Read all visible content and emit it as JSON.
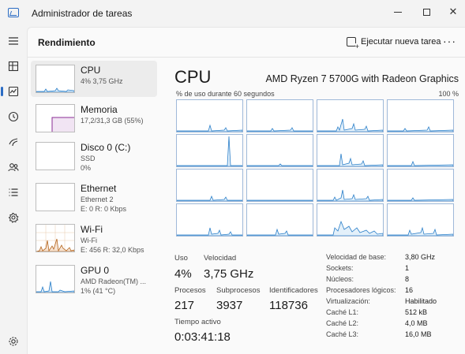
{
  "app": {
    "title": "Administrador de tareas"
  },
  "header": {
    "title": "Rendimiento",
    "run_task_label": "Ejecutar nueva tarea",
    "more_label": "···"
  },
  "colors": {
    "cpu": "#2a7fc9",
    "memory": "#8a2b96",
    "wifi": "#b5651d"
  },
  "nav": [
    "hamburger-icon",
    "processes-icon",
    "performance-icon",
    "history-icon",
    "startup-icon",
    "users-icon",
    "details-icon",
    "services-icon",
    "settings-icon"
  ],
  "devices": [
    {
      "name": "CPU",
      "line1": "4% 3,75 GHz",
      "line2": ""
    },
    {
      "name": "Memoria",
      "line1": "17,2/31,3 GB (55%)",
      "line2": ""
    },
    {
      "name": "Disco 0 (C:)",
      "line1": "SSD",
      "line2": "0%"
    },
    {
      "name": "Ethernet",
      "line1": "Ethernet 2",
      "line2": "E: 0 R: 0 Kbps"
    },
    {
      "name": "Wi-Fi",
      "line1": "Wi-Fi",
      "line2": "E: 456 R: 32,0 Kbps"
    },
    {
      "name": "GPU 0",
      "line1": "AMD Radeon(TM) ...",
      "line2": "1% (41 °C)"
    }
  ],
  "detail": {
    "title": "CPU",
    "model": "AMD Ryzen 7 5700G with Radeon Graphics",
    "graph_label": "% de uso durante 60 segundos",
    "graph_max": "100 %",
    "stats": {
      "uso_label": "Uso",
      "uso_value": "4%",
      "velocidad_label": "Velocidad",
      "velocidad_value": "3,75 GHz",
      "procesos_label": "Procesos",
      "procesos_value": "217",
      "subprocesos_label": "Subprocesos",
      "subprocesos_value": "3937",
      "identificadores_label": "Identificadores",
      "identificadores_value": "118736",
      "tiempo_label": "Tiempo activo",
      "tiempo_value": "0:03:41:18"
    },
    "properties": [
      {
        "key": "Velocidad de base:",
        "value": "3,80 GHz"
      },
      {
        "key": "Sockets:",
        "value": "1"
      },
      {
        "key": "Núcleos:",
        "value": "8"
      },
      {
        "key": "Procesadores lógicos:",
        "value": "16"
      },
      {
        "key": "Virtualización:",
        "value": "Habilitado"
      },
      {
        "key": "Caché L1:",
        "value": "512 kB"
      },
      {
        "key": "Caché L2:",
        "value": "4,0 MB"
      },
      {
        "key": "Caché L3:",
        "value": "16,0 MB"
      }
    ]
  }
}
